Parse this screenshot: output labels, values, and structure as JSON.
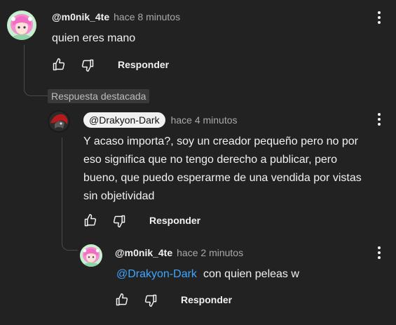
{
  "comments": [
    {
      "author": "@m0nik_4te",
      "time": "hace 8 minutos",
      "text": "quien eres mano",
      "reply_label": "Responder"
    },
    {
      "badge": "Respuesta destacada",
      "author": "@Drakyon-Dark",
      "time": "hace 4 minutos",
      "text_lines": [
        "Y acaso importa?, soy un creador pequeño pero no por",
        "eso significa que no tengo derecho a publicar, pero",
        "bueno, que puedo esperarme de una vendida por vistas",
        "sin objetividad"
      ],
      "reply_label": "Responder"
    },
    {
      "author": "@m0nik_4te",
      "time": "hace 2 minutos",
      "mention": "@Drakyon-Dark",
      "text": "con quien peleas w",
      "reply_label": "Responder"
    }
  ],
  "colors": {
    "background": "#222222",
    "text": "#f1f1f1",
    "muted": "#aaaaaa",
    "link": "#3ea6ff"
  },
  "icons": [
    "thumbs-up-icon",
    "thumbs-down-icon",
    "kebab-menu-icon"
  ]
}
